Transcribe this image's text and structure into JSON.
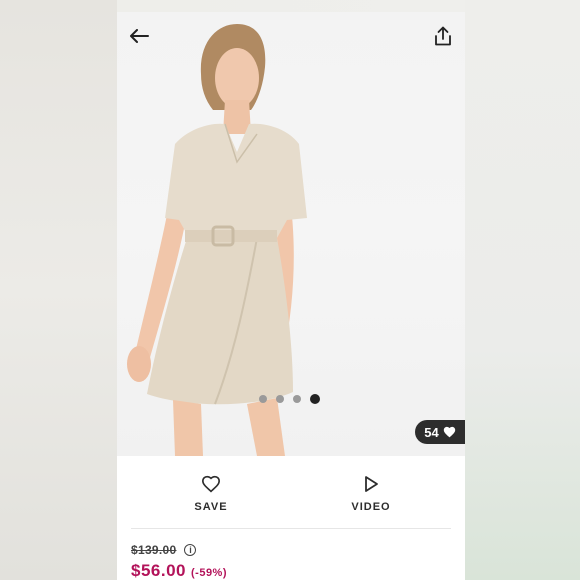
{
  "header": {
    "back_icon": "arrow-left-icon",
    "share_icon": "share-icon"
  },
  "gallery": {
    "dot_count": 4,
    "active_dot_index": 3,
    "likes_count": "54",
    "likes_icon": "heart-icon"
  },
  "actions": {
    "save_label": "SAVE",
    "save_icon": "heart-outline-icon",
    "video_label": "VIDEO",
    "video_icon": "play-icon"
  },
  "price": {
    "original": "$139.00",
    "current": "$56.00",
    "discount": "(-59%)",
    "info_icon_glyph": "i"
  },
  "colors": {
    "sale": "#b3135a",
    "text": "#2d2d2d",
    "badge_bg": "#2d2d2d"
  }
}
